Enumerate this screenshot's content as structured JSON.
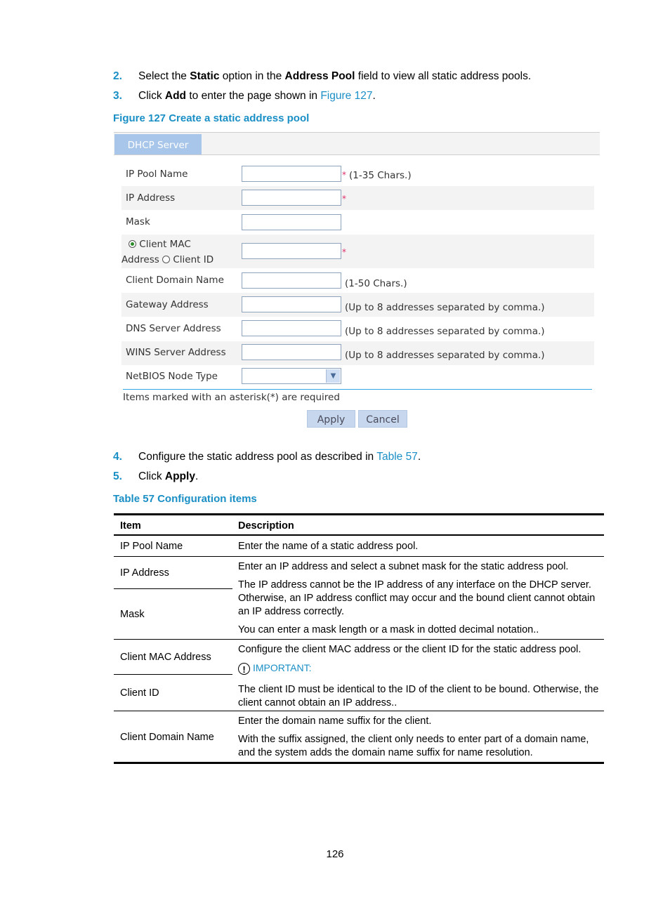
{
  "steps": [
    {
      "num": "2.",
      "parts": [
        "Select the ",
        "Static",
        " option in the ",
        "Address Pool",
        " field to view all static address pools."
      ]
    },
    {
      "num": "3.",
      "parts": [
        "Click ",
        "Add",
        " to enter the page shown in ",
        "Figure 127",
        "."
      ]
    },
    {
      "num": "4.",
      "parts": [
        "Configure the static address pool as described in ",
        "Table 57",
        "."
      ]
    },
    {
      "num": "5.",
      "parts": [
        "Click ",
        "Apply",
        "."
      ]
    }
  ],
  "figure_caption": "Figure 127 Create a static address pool",
  "form": {
    "tab": "DHCP Server",
    "fields": [
      {
        "label": "IP Pool Name",
        "value": "",
        "required": "*",
        "hint": "(1-35 Chars.)"
      },
      {
        "label": "IP Address",
        "value": "",
        "required": "*",
        "hint": ""
      },
      {
        "label": "Mask",
        "value": "",
        "required": "",
        "hint": ""
      },
      {
        "label": "",
        "value": "",
        "required": "*",
        "hint": ""
      },
      {
        "label": "Client Domain Name",
        "value": "",
        "required": "",
        "hint": "(1-50 Chars.)"
      },
      {
        "label": "Gateway Address",
        "value": "",
        "required": "",
        "hint": "(Up to 8 addresses separated by comma.)"
      },
      {
        "label": "DNS Server Address",
        "value": "",
        "required": "",
        "hint": "(Up to 8 addresses separated by comma.)"
      },
      {
        "label": "WINS Server Address",
        "value": "",
        "required": "",
        "hint": "(Up to 8 addresses separated by comma.)"
      },
      {
        "label": "NetBIOS Node Type",
        "value": "",
        "required": "",
        "hint": ""
      }
    ],
    "radio": {
      "option1": "Client MAC",
      "option1_cont": "Address",
      "option2": "Client ID",
      "selected": "Client MAC Address"
    },
    "required_note": "Items marked with an asterisk(*) are required",
    "apply": "Apply",
    "cancel": "Cancel"
  },
  "table_caption": "Table 57 Configuration items",
  "table": {
    "headers": [
      "Item",
      "Description"
    ],
    "items": [
      "IP Pool Name",
      "IP Address",
      "Mask",
      "Client MAC Address",
      "Client ID",
      "Client Domain Name"
    ],
    "descriptions": {
      "pool": "Enter the name of a static address pool.",
      "ip1": "Enter an IP address and select a subnet mask for the static address pool.",
      "ip2": "The IP address cannot be the IP address of any interface on the DHCP server. Otherwise, an IP address conflict may occur and the bound client cannot obtain an IP address correctly.",
      "ip3": "You can enter a mask length or a mask in dotted decimal notation..",
      "mac1": "Configure the client MAC address or the client ID for the static address pool.",
      "important": "IMPORTANT:",
      "mac2": "The client ID must be identical to the ID of the client to be bound. Otherwise, the client cannot obtain an IP address..",
      "dom1": "Enter the domain name suffix for the client.",
      "dom2": "With the suffix assigned, the client only needs to enter part of a domain name, and the system adds the domain name suffix for name resolution."
    }
  },
  "page_number": "126",
  "colors": {
    "accent": "#1a8fc6",
    "tab": "#a8c6e9",
    "required": "#e0306a"
  }
}
